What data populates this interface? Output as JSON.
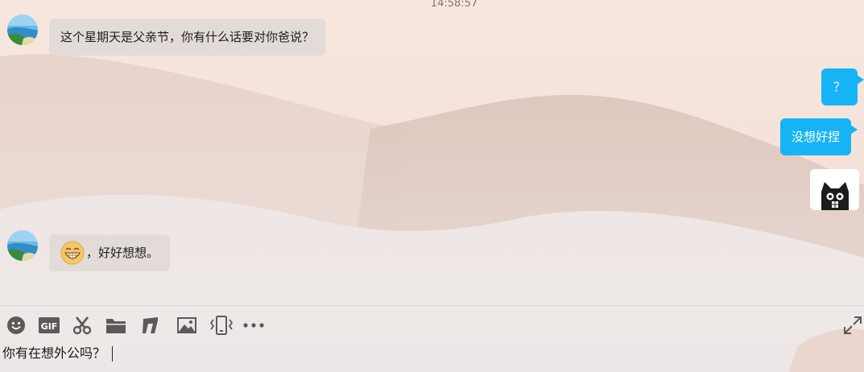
{
  "chat": {
    "timestamp": "14:58:57",
    "messages": [
      {
        "side": "left",
        "text": "这个星期天是父亲节，你有什么话要对你爸说？"
      },
      {
        "side": "right",
        "text": "？"
      },
      {
        "side": "right",
        "text": "没想好捏"
      },
      {
        "side": "right",
        "type": "sticker",
        "icon": "black-cat-sticker"
      },
      {
        "side": "left",
        "emoji": "grin-emoji",
        "text": "，好好想想。"
      }
    ]
  },
  "toolbar": {
    "items": [
      "emoji-icon",
      "gif-icon",
      "screenshot-scissors-icon",
      "folder-icon",
      "music-icon",
      "image-icon",
      "shake-icon",
      "more-icon"
    ],
    "gif_label": "GIF",
    "expand": "expand-icon"
  },
  "input": {
    "value": "你有在想外公吗？"
  },
  "colors": {
    "bubble_right": "#17b4f5",
    "bubble_left": "#e0dad6",
    "icon": "#5a5a5a"
  }
}
